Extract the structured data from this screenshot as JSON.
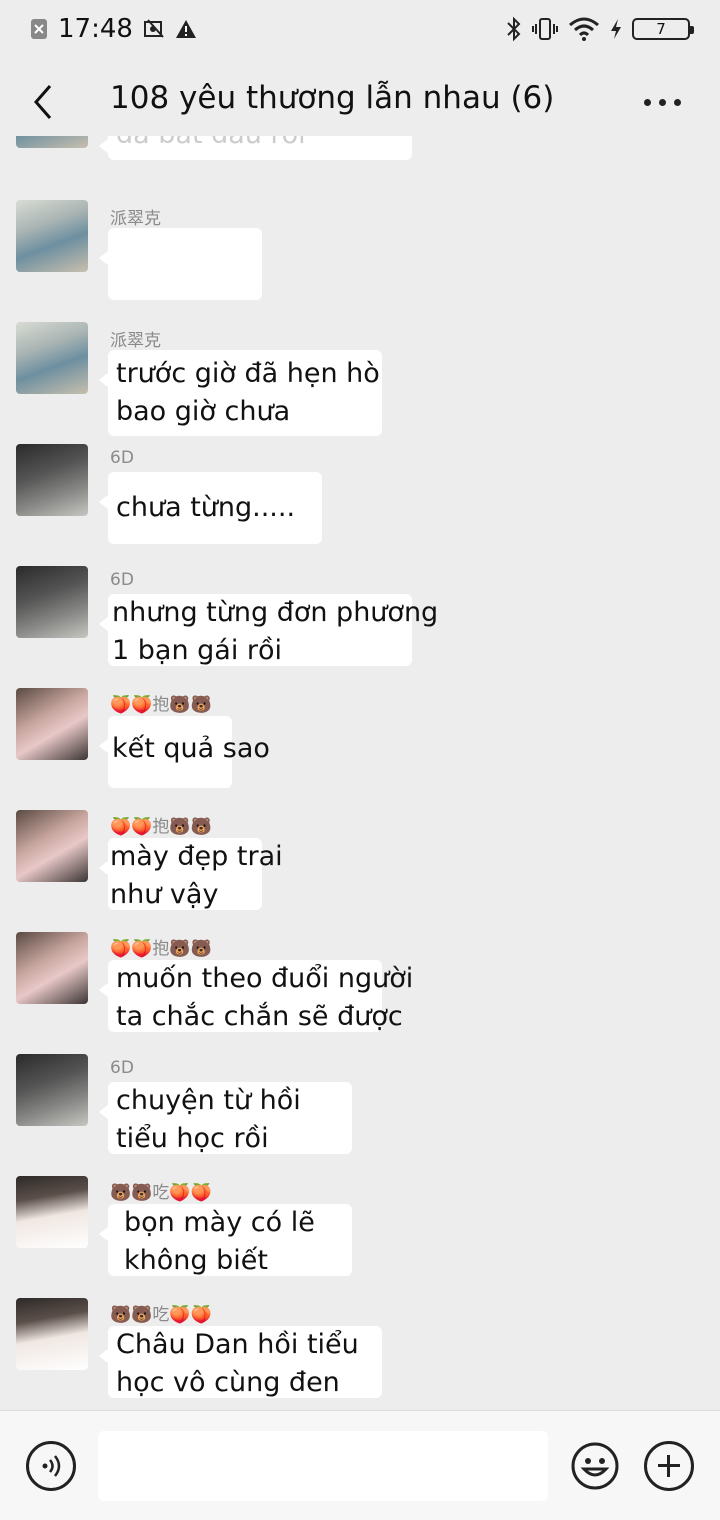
{
  "status_bar": {
    "time": "17:48",
    "battery_level": "7"
  },
  "header": {
    "title": "108 yêu thương lẫn nhau (6)"
  },
  "messages": [
    {
      "sender": "",
      "lines": [
        "đã bắt đầu rồi"
      ],
      "avatar": "av-a"
    },
    {
      "sender": "派翠克",
      "lines": [
        ""
      ],
      "avatar": "av-a"
    },
    {
      "sender": "派翠克",
      "lines": [
        "trước giờ đã hẹn hò",
        "bao giờ chưa"
      ],
      "avatar": "av-a"
    },
    {
      "sender": "6D",
      "lines": [
        "chưa từng....."
      ],
      "avatar": "av-b"
    },
    {
      "sender": "6D",
      "lines": [
        "nhưng từng đơn phương",
        "1 bạn gái rồi"
      ],
      "avatar": "av-b"
    },
    {
      "sender": "🍑🍑抱🐻🐻",
      "lines": [
        "kết quả sao"
      ],
      "avatar": "av-c"
    },
    {
      "sender": "🍑🍑抱🐻🐻",
      "lines": [
        "mày đẹp trai",
        "như vậy"
      ],
      "avatar": "av-c"
    },
    {
      "sender": "🍑🍑抱🐻🐻",
      "lines": [
        "muốn theo đuổi người",
        "ta chắc chắn sẽ được"
      ],
      "avatar": "av-c"
    },
    {
      "sender": "6D",
      "lines": [
        "chuyện từ hồi",
        "tiểu học rồi"
      ],
      "avatar": "av-b"
    },
    {
      "sender": "🐻🐻吃🍑🍑",
      "lines": [
        "bọn mày có lẽ",
        "không biết"
      ],
      "avatar": "av-d"
    },
    {
      "sender": "🐻🐻吃🍑🍑",
      "lines": [
        "Châu Dan hồi tiểu",
        "học vô cùng đen"
      ],
      "avatar": "av-d"
    }
  ],
  "input_bar": {
    "placeholder": ""
  }
}
